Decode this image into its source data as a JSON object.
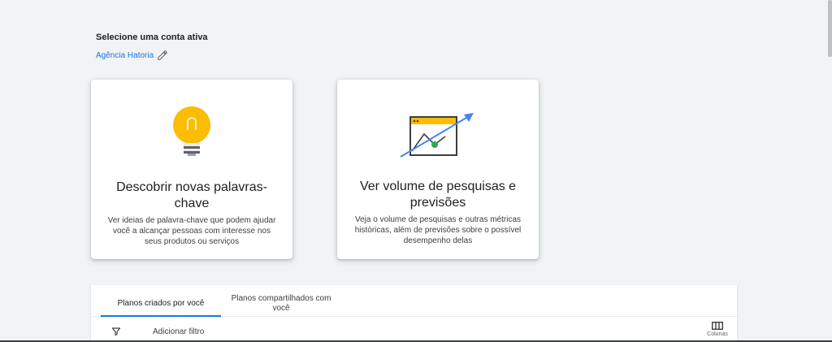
{
  "account": {
    "heading": "Selecione uma conta ativa",
    "name": "Agência Hatoria"
  },
  "cards": [
    {
      "title": "Descobrir novas palavras-chave",
      "description": "Ver ideias de palavra-chave que podem ajudar você a alcançar pessoas com interesse nos seus produtos ou serviços",
      "icon": "lightbulb-icon"
    },
    {
      "title": "Ver volume de pesquisas e previsões",
      "description": "Veja o volume de pesquisas e outras métricas históricas, além de previsões sobre o possível desempenho delas",
      "icon": "trend-chart-icon"
    }
  ],
  "plans": {
    "tabs": [
      {
        "label": "Planos criados por você",
        "active": true
      },
      {
        "label": "Planos compartilhados com você",
        "active": false
      }
    ],
    "filter_label": "Adicionar filtro",
    "columns_label": "Colunas"
  },
  "colors": {
    "accent": "#1a73e8",
    "bulb": "#fbbc04",
    "green_dot": "#34a853",
    "background": "#f1f3f4"
  }
}
